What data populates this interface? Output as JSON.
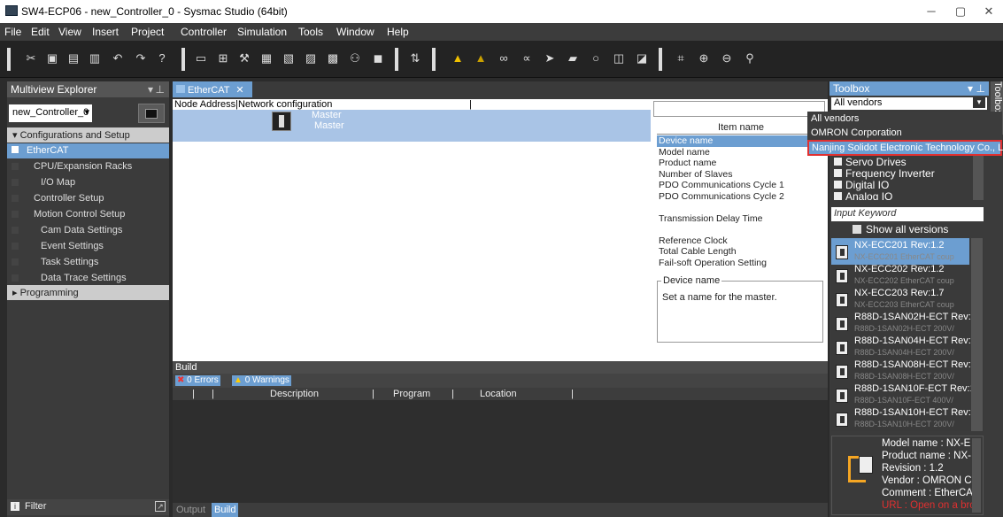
{
  "titlebar": {
    "title": "SW4-ECP06 - new_Controller_0 - Sysmac Studio (64bit)",
    "min": "─",
    "max": "▢",
    "close": "✕"
  },
  "menu": [
    "File",
    "Edit",
    "View",
    "Insert",
    "Project",
    "Controller",
    "Simulation",
    "Tools",
    "Window",
    "Help"
  ],
  "left": {
    "header": "Multiview Explorer",
    "controller": "new_Controller_0",
    "tree": [
      {
        "label": "Configurations and Setup",
        "kind": "group"
      },
      {
        "label": "EtherCAT",
        "kind": "selected"
      },
      {
        "label": "CPU/Expansion Racks",
        "kind": "item"
      },
      {
        "label": "I/O Map",
        "kind": "item"
      },
      {
        "label": "Controller Setup",
        "kind": "item"
      },
      {
        "label": "Motion Control Setup",
        "kind": "item"
      },
      {
        "label": "Cam Data Settings",
        "kind": "item"
      },
      {
        "label": "Event Settings",
        "kind": "item"
      },
      {
        "label": "Task Settings",
        "kind": "item"
      },
      {
        "label": "Data Trace Settings",
        "kind": "item"
      },
      {
        "label": "Programming",
        "kind": "group"
      }
    ],
    "filter": "Filter"
  },
  "center": {
    "tab": "EtherCAT",
    "net_header": "Node Address|Network configuration",
    "master_title": "Master",
    "master_sub": "Master",
    "item_name_header": "Item name",
    "props": [
      "Device name",
      "Model name",
      "Product name",
      "Number of Slaves",
      "PDO Communications Cycle 1",
      "PDO Communications Cycle 2",
      "",
      "Transmission Delay Time",
      "",
      "Reference Clock",
      "Total Cable Length",
      "Fail-soft Operation Setting"
    ],
    "desc_title": "Device name",
    "desc_text": "Set a name for the master."
  },
  "build": {
    "header": "Build",
    "errors": "0  Errors",
    "warnings": "0  Warnings",
    "columns": [
      "Description",
      "Program",
      "Location"
    ],
    "tabs": [
      "Output",
      "Build"
    ]
  },
  "toolbox": {
    "header": "Toolbox",
    "side_label": "Toolbox",
    "vendor_selected": "All vendors",
    "vendors": [
      "All vendors",
      "OMRON Corporation",
      "Nanjing Solidot Electronic Technology Co., Ltd."
    ],
    "categories": [
      "Servo Drives",
      "Frequency Inverter",
      "Digital IO",
      "Analog IO"
    ],
    "keyword_placeholder": "Input Keyword",
    "show_all": "Show all versions",
    "devices": [
      {
        "name": "NX-ECC201 Rev:1.2",
        "sub": "NX-ECC201 EtherCAT coup"
      },
      {
        "name": "NX-ECC202 Rev:1.2",
        "sub": "NX-ECC202 EtherCAT coup"
      },
      {
        "name": "NX-ECC203 Rev:1.7",
        "sub": "NX-ECC203 EtherCAT coup"
      },
      {
        "name": "R88D-1SAN02H-ECT Rev:",
        "sub": "R88D-1SAN02H-ECT 200V/"
      },
      {
        "name": "R88D-1SAN04H-ECT Rev:",
        "sub": "R88D-1SAN04H-ECT 200V/"
      },
      {
        "name": "R88D-1SAN08H-ECT Rev:",
        "sub": "R88D-1SAN08H-ECT 200V/"
      },
      {
        "name": "R88D-1SAN10F-ECT Rev:1",
        "sub": "R88D-1SAN10F-ECT 400V/"
      },
      {
        "name": "R88D-1SAN10H-ECT Rev:",
        "sub": "R88D-1SAN10H-ECT 200V/"
      }
    ],
    "info": [
      "Model name : NX-E",
      "Product name : NX-",
      "Revision : 1.2",
      "Vendor : OMRON C",
      "Comment : EtherCA",
      "URL : Open on a bro"
    ]
  }
}
